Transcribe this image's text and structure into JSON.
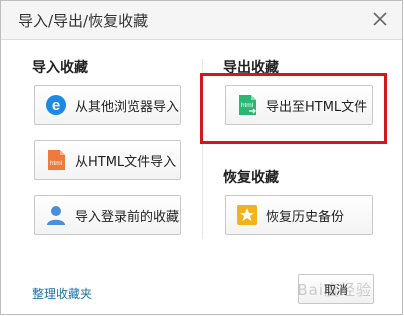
{
  "dialog": {
    "title": "导入/导出/恢复收藏",
    "close_icon": "close-icon"
  },
  "import_section": {
    "heading": "导入收藏",
    "buttons": [
      {
        "label": "从其他浏览器导入",
        "icon": "ie-browser-icon"
      },
      {
        "label": "从HTML文件导入",
        "icon": "html-file-import-icon"
      },
      {
        "label": "导入登录前的收藏",
        "icon": "user-icon"
      }
    ]
  },
  "export_section": {
    "heading": "导出收藏",
    "buttons": [
      {
        "label": "导出至HTML文件",
        "icon": "html-file-export-icon"
      }
    ]
  },
  "restore_section": {
    "heading": "恢复收藏",
    "buttons": [
      {
        "label": "恢复历史备份",
        "icon": "star-icon"
      }
    ]
  },
  "footer": {
    "manage_link": "整理收藏夹",
    "cancel_label": "取消"
  },
  "watermark": "Bai度经验",
  "colors": {
    "highlight_border": "#d0181d",
    "link": "#1a73a8",
    "ie_blue": "#1e88e5",
    "html_orange": "#f07a3e",
    "html_green": "#2bb673",
    "star_gold": "#f2b21a",
    "user_blue": "#4a8fd8"
  }
}
